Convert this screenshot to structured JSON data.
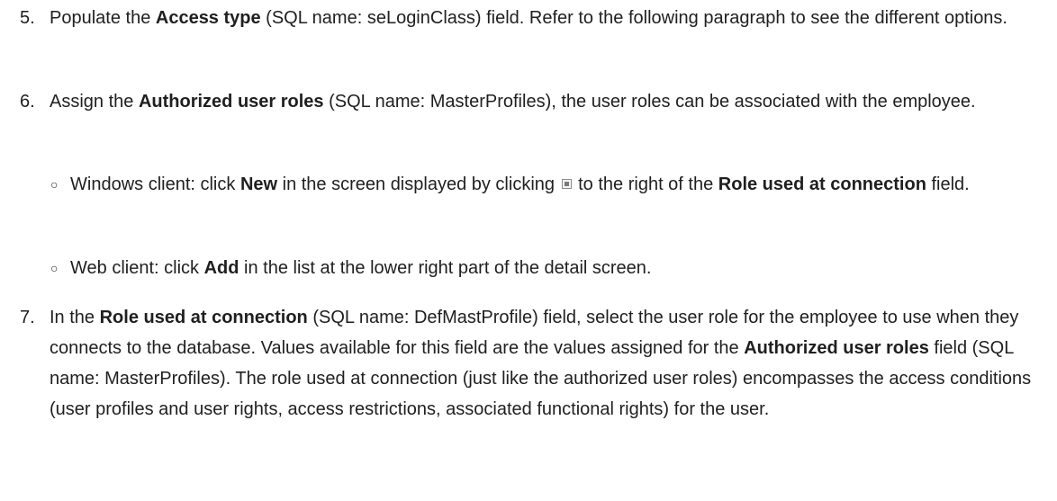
{
  "steps": [
    {
      "number": "5.",
      "parts": [
        "Populate the ",
        "Access type",
        " (SQL name: seLoginClass) field. Refer to the following paragraph to see the different options."
      ]
    },
    {
      "number": "6.",
      "parts": [
        "Assign the ",
        "Authorized user roles",
        " (SQL name: MasterProfiles), the user roles can be associated with the employee."
      ],
      "subitems": [
        {
          "bullet": "○",
          "parts": [
            "Windows client: click ",
            "New",
            " in the screen displayed by clicking ",
            "to the right of the ",
            "Role used at connection",
            " field."
          ],
          "icon": "browse-button-icon"
        },
        {
          "bullet": "○",
          "parts": [
            "Web client: click ",
            "Add",
            " in the list at the lower right part of the detail screen."
          ]
        }
      ]
    },
    {
      "number": "7.",
      "parts": [
        "In the ",
        "Role used at connection",
        " (SQL name: DefMastProfile) field, select the user role for the employee to use when they connects to the database. Values available for this field are the values assigned for the ",
        "Authorized user roles",
        " field (SQL name: MasterProfiles). The role used at connection (just like the authorized user roles) encompasses the access conditions (user profiles and user rights, access restrictions, associated functional rights) for the user."
      ]
    }
  ]
}
